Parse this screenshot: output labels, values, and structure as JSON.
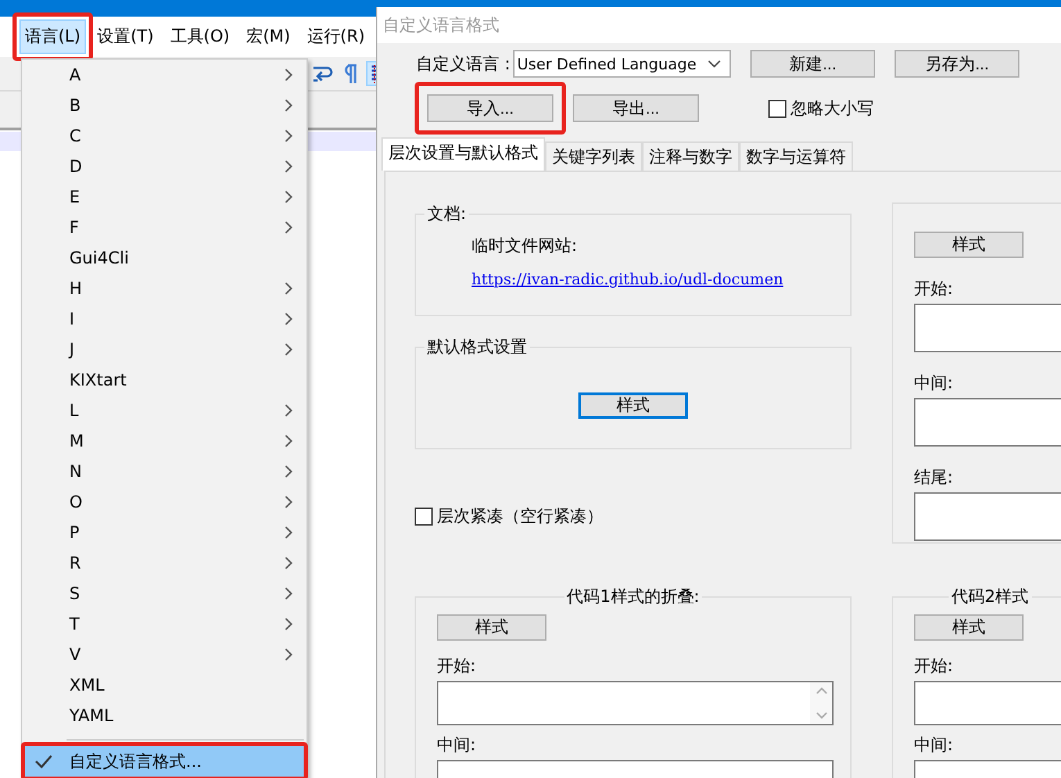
{
  "editor": {
    "menu": [
      {
        "label": "语言(L)",
        "selected": true,
        "annotated": true
      },
      {
        "label": "设置(T)",
        "selected": false,
        "annotated": false
      },
      {
        "label": "工具(O)",
        "selected": false,
        "annotated": false
      },
      {
        "label": "宏(M)",
        "selected": false,
        "annotated": false
      },
      {
        "label": "运行(R)",
        "selected": false,
        "annotated": false
      }
    ]
  },
  "language_menu": {
    "items": [
      {
        "label": "A",
        "submenu": true,
        "checked": false,
        "selected": false,
        "annotated": false
      },
      {
        "label": "B",
        "submenu": true,
        "checked": false,
        "selected": false,
        "annotated": false
      },
      {
        "label": "C",
        "submenu": true,
        "checked": false,
        "selected": false,
        "annotated": false
      },
      {
        "label": "D",
        "submenu": true,
        "checked": false,
        "selected": false,
        "annotated": false
      },
      {
        "label": "E",
        "submenu": true,
        "checked": false,
        "selected": false,
        "annotated": false
      },
      {
        "label": "F",
        "submenu": true,
        "checked": false,
        "selected": false,
        "annotated": false
      },
      {
        "label": "Gui4Cli",
        "submenu": false,
        "checked": false,
        "selected": false,
        "annotated": false
      },
      {
        "label": "H",
        "submenu": true,
        "checked": false,
        "selected": false,
        "annotated": false
      },
      {
        "label": "I",
        "submenu": true,
        "checked": false,
        "selected": false,
        "annotated": false
      },
      {
        "label": "J",
        "submenu": true,
        "checked": false,
        "selected": false,
        "annotated": false
      },
      {
        "label": "KIXtart",
        "submenu": false,
        "checked": false,
        "selected": false,
        "annotated": false
      },
      {
        "label": "L",
        "submenu": true,
        "checked": false,
        "selected": false,
        "annotated": false
      },
      {
        "label": "M",
        "submenu": true,
        "checked": false,
        "selected": false,
        "annotated": false
      },
      {
        "label": "N",
        "submenu": true,
        "checked": false,
        "selected": false,
        "annotated": false
      },
      {
        "label": "O",
        "submenu": true,
        "checked": false,
        "selected": false,
        "annotated": false
      },
      {
        "label": "P",
        "submenu": true,
        "checked": false,
        "selected": false,
        "annotated": false
      },
      {
        "label": "R",
        "submenu": true,
        "checked": false,
        "selected": false,
        "annotated": false
      },
      {
        "label": "S",
        "submenu": true,
        "checked": false,
        "selected": false,
        "annotated": false
      },
      {
        "label": "T",
        "submenu": true,
        "checked": false,
        "selected": false,
        "annotated": false
      },
      {
        "label": "V",
        "submenu": true,
        "checked": false,
        "selected": false,
        "annotated": false
      },
      {
        "label": "XML",
        "submenu": false,
        "checked": false,
        "selected": false,
        "annotated": false
      },
      {
        "label": "YAML",
        "submenu": false,
        "checked": false,
        "selected": false,
        "annotated": false
      },
      {
        "label": "自定义语言格式...",
        "submenu": false,
        "checked": true,
        "selected": true,
        "annotated": true,
        "separator_before": true
      }
    ]
  },
  "dialog": {
    "title": "自定义语言格式",
    "language_label": "自定义语言 :",
    "language_value": "User Defined Language",
    "top_buttons": [
      {
        "label": "新建...",
        "annotated": false
      },
      {
        "label": "另存为...",
        "annotated": false
      }
    ],
    "second_buttons": [
      {
        "label": "导入...",
        "annotated": true
      },
      {
        "label": "导出...",
        "annotated": false
      }
    ],
    "ignore_case": {
      "label": "忽略大小写",
      "checked": false
    },
    "tabs": [
      {
        "label": "层次设置与默认格式",
        "selected": true
      },
      {
        "label": "关键字列表",
        "selected": false
      },
      {
        "label": "注释与数字",
        "selected": false
      },
      {
        "label": "数字与运算符",
        "selected": false
      }
    ],
    "documents": {
      "title": "文档:",
      "site_label": "临时文件网站:",
      "link": "https://ivan-radic.github.io/udl-documen"
    },
    "default_style": {
      "title": "默认格式设置",
      "button": "样式",
      "focused": true
    },
    "compact": {
      "label": "层次紧凑（空行紧凑）",
      "checked": false
    },
    "column_2_group": {
      "button": "样式",
      "fields": [
        "开始:",
        "中间:",
        "结尾:"
      ]
    },
    "fold_1": {
      "title": "代码1样式的折叠:",
      "button": "样式",
      "fields": [
        "开始:",
        "中间:"
      ]
    },
    "fold_2": {
      "title": "代码2样式",
      "button": "样式",
      "fields": [
        "开始:",
        "中间:"
      ]
    }
  }
}
